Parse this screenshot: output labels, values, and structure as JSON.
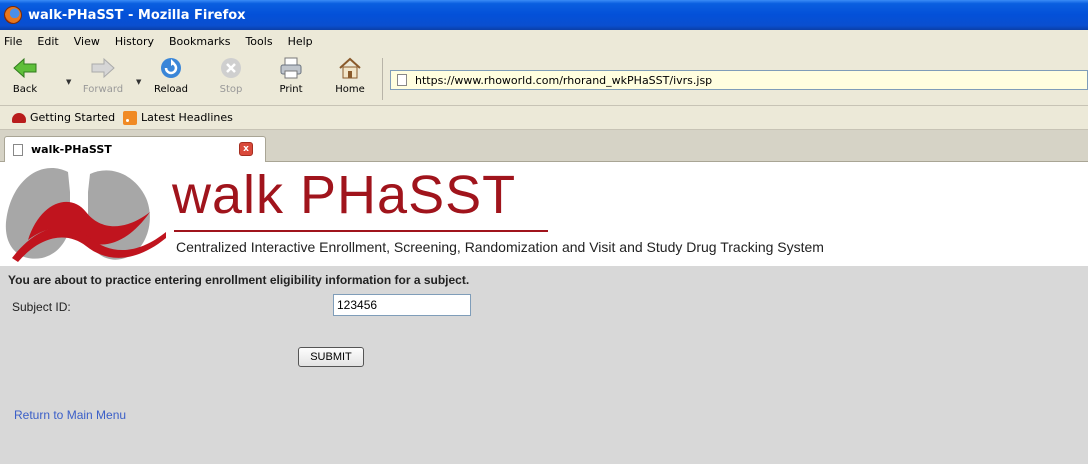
{
  "window": {
    "title": "walk-PHaSST - Mozilla Firefox"
  },
  "menu": [
    "File",
    "Edit",
    "View",
    "History",
    "Bookmarks",
    "Tools",
    "Help"
  ],
  "nav": {
    "back": "Back",
    "forward": "Forward",
    "reload": "Reload",
    "stop": "Stop",
    "print": "Print",
    "home": "Home",
    "url": "https://www.rhoworld.com/rhorand_wkPHaSST/ivrs.jsp"
  },
  "bookmarks": [
    "Getting Started",
    "Latest Headlines"
  ],
  "tab": {
    "title": "walk-PHaSST",
    "close": "x"
  },
  "banner": {
    "title": "walk PHaSST",
    "subtitle": "Centralized Interactive Enrollment, Screening, Randomization and Visit and Study Drug Tracking System"
  },
  "form": {
    "intro": "You are about to practice entering enrollment eligibility information for a subject.",
    "subject_label": "Subject ID:",
    "subject_value": "123456",
    "submit": "SUBMIT"
  },
  "link": {
    "return": "Return to Main Menu"
  },
  "colors": {
    "brand": "#a0141c",
    "link": "#3b5fc8",
    "content_bg": "#d8d8d8",
    "titlebar": "#0350d8"
  }
}
